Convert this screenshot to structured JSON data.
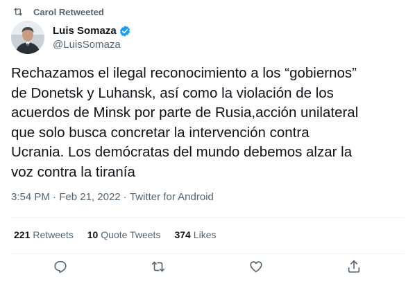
{
  "retweet_context": {
    "icon": "retweet-icon",
    "text": "Carol Retweeted"
  },
  "author": {
    "name": "Luis Somaza",
    "handle": "@LuisSomaza",
    "verified_icon": "verified-badge-icon",
    "verified_color": "#1d9bf0"
  },
  "tweet": {
    "text": "Rechazamos el ilegal reconocimiento a los “gobiernos”\nde Donetsk y Luhansk, así como la violación de los\nacuerdos de Minsk por parte de Rusia,acción unilateral\nque solo busca concretar la intervención contra\nUcrania. Los demócratas del mundo debemos alzar la\nvoz contra la tiranía"
  },
  "meta": {
    "time": "3:54 PM",
    "separator": " · ",
    "date": "Feb 21, 2022",
    "source": "Twitter for Android"
  },
  "stats": {
    "retweets_count": "221",
    "retweets_label": "Retweets",
    "quotes_count": "10",
    "quotes_label": "Quote Tweets",
    "likes_count": "374",
    "likes_label": "Likes"
  },
  "actions": {
    "reply_icon": "reply-icon",
    "retweet_icon": "retweet-icon",
    "like_icon": "heart-icon",
    "share_icon": "share-icon"
  },
  "colors": {
    "text_primary": "#0f1419",
    "text_secondary": "#536471",
    "accent": "#1d9bf0",
    "divider": "#eff3f4"
  }
}
